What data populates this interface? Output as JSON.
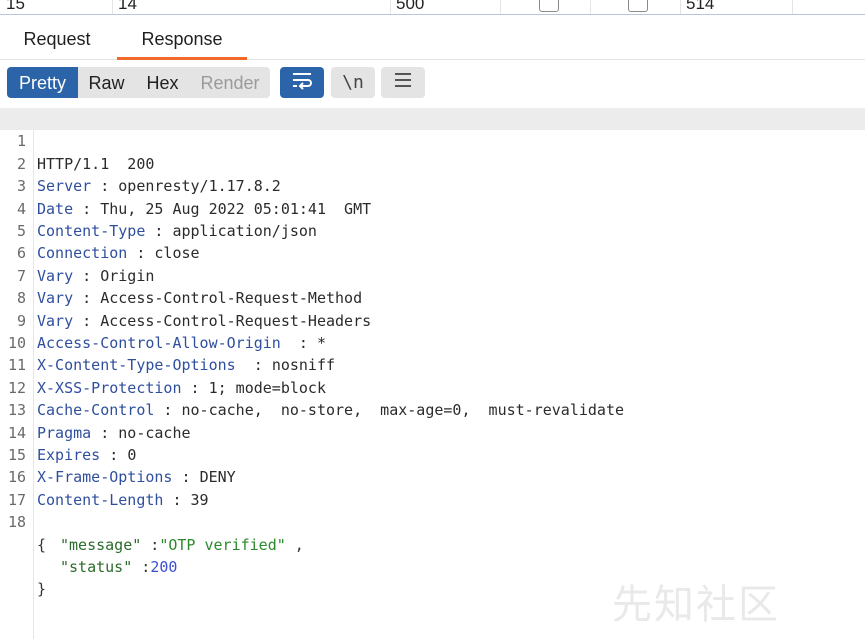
{
  "table_row": {
    "num": "15",
    "payload": "14",
    "status": "500",
    "length": "514"
  },
  "tabs": [
    {
      "label": "Request",
      "active": false
    },
    {
      "label": "Response",
      "active": true
    }
  ],
  "view_modes": [
    {
      "label": "Pretty",
      "active": true
    },
    {
      "label": "Raw",
      "active": false
    },
    {
      "label": "Hex",
      "active": false
    },
    {
      "label": "Render",
      "active": false
    }
  ],
  "toolbar_icons": [
    "wrap-lines-icon",
    "newline-toggle-icon",
    "menu-icon"
  ],
  "newline_label": "\\n",
  "accent_color": "#f26a2b",
  "active_button_color": "#2b64a8",
  "response": {
    "status_line": "HTTP/1.1  200",
    "headers": [
      {
        "name": "Server",
        "sep": " : ",
        "value": "openresty/1.17.8.2"
      },
      {
        "name": "Date",
        "sep": " : ",
        "value": "Thu, 25 Aug 2022 05:01:41  GMT"
      },
      {
        "name": "Content-Type",
        "sep": " : ",
        "value": "application/json"
      },
      {
        "name": "Connection",
        "sep": " : ",
        "value": "close"
      },
      {
        "name": "Vary",
        "sep": " : ",
        "value": "Origin"
      },
      {
        "name": "Vary",
        "sep": " : ",
        "value": "Access-Control-Request-Method"
      },
      {
        "name": "Vary",
        "sep": " : ",
        "value": "Access-Control-Request-Headers"
      },
      {
        "name": "Access-Control-Allow-Origin",
        "sep": "  : ",
        "value": "*"
      },
      {
        "name": "X-Content-Type-Options",
        "sep": "  : ",
        "value": "nosniff"
      },
      {
        "name": "X-XSS-Protection",
        "sep": " : ",
        "value": "1; mode=block"
      },
      {
        "name": "Cache-Control",
        "sep": " : ",
        "value": "no-cache,  no-store,  max-age=0,  must-revalidate"
      },
      {
        "name": "Pragma",
        "sep": " : ",
        "value": "no-cache"
      },
      {
        "name": "Expires",
        "sep": " : ",
        "value": "0"
      },
      {
        "name": "X-Frame-Options",
        "sep": " : ",
        "value": "DENY"
      },
      {
        "name": "Content-Length",
        "sep": " : ",
        "value": "39"
      }
    ],
    "body": {
      "open": "{",
      "fields": [
        {
          "key": "\"message\"",
          "sep": " :",
          "value": "\"OTP verified\"",
          "trail": " ,",
          "type": "string"
        },
        {
          "key": "\"status\"",
          "sep": " :",
          "value": "200",
          "trail": "",
          "type": "number"
        }
      ],
      "close": "}"
    },
    "line_numbers": [
      "1",
      "2",
      "3",
      "4",
      "5",
      "6",
      "7",
      "8",
      "9",
      "10",
      "11",
      "12",
      "13",
      "14",
      "15",
      "16",
      "17",
      "18"
    ]
  },
  "watermark": "先知社区"
}
